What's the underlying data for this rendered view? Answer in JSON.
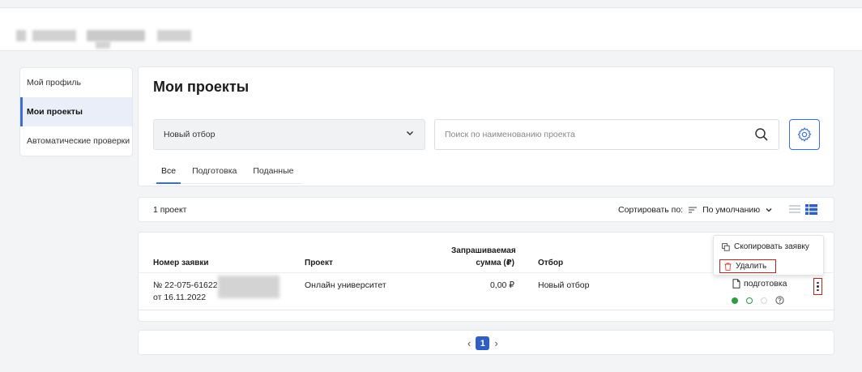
{
  "sidebar": {
    "items": [
      {
        "label": "Мой профиль"
      },
      {
        "label": "Мои проекты"
      },
      {
        "label": "Автоматические проверки"
      }
    ]
  },
  "page": {
    "title": "Мои проекты",
    "filter_select": {
      "value": "Новый отбор"
    },
    "search": {
      "placeholder": "Поиск по наименованию проекта"
    },
    "tabs": [
      {
        "label": "Все"
      },
      {
        "label": "Подготовка"
      },
      {
        "label": "Поданные"
      }
    ]
  },
  "summary": {
    "count": "1 проект",
    "sort_label": "Сортировать по:",
    "sort_value": "По умолчанию"
  },
  "table": {
    "headers": {
      "number": "Номер заявки",
      "project": "Проект",
      "amount_line1": "Запрашиваемая",
      "amount_line2": "сумма (₽)",
      "selection": "Отбор"
    },
    "rows": [
      {
        "number": "№ 22-075-61622",
        "date": "от 16.11.2022",
        "project": "Онлайн университет",
        "amount": "0,00 ₽",
        "selection": "Новый отбор",
        "status": "подготовка"
      }
    ]
  },
  "context_menu": {
    "copy": "Скопировать заявку",
    "delete": "Удалить"
  },
  "pagination": {
    "current": "1"
  },
  "colors": {
    "accent": "#3a6fd0",
    "highlight_border": "#b3261e",
    "status_done": "#2e9b45"
  }
}
